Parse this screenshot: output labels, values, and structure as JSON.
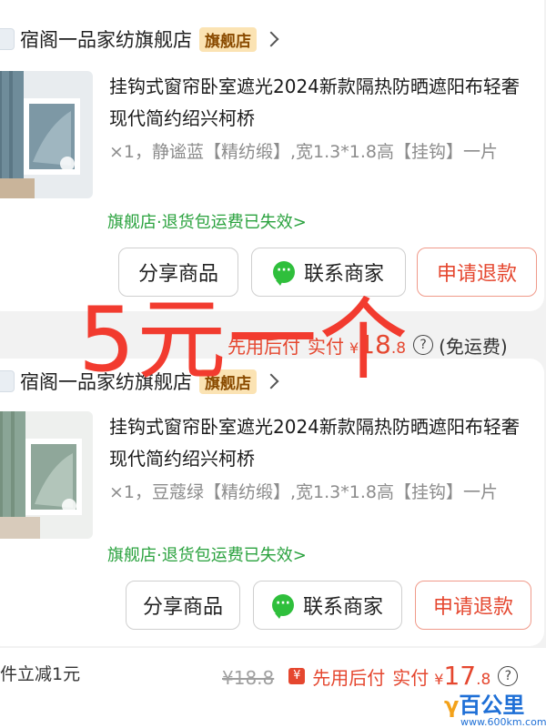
{
  "orders": [
    {
      "shop": {
        "name": "宿阁一品家纺旗舰店",
        "badge": "旗舰店"
      },
      "product": {
        "title": "挂钩式窗帘卧室遮光2024新款隔热防晒遮阳布轻奢现代简约绍兴柯桥",
        "sku": "×1，静谧蓝【精纺缎】,宽1.3*1.8高【挂钩】一片",
        "policy": "旗舰店·退货包运费已失效>",
        "thumb_color": "#7d98a5"
      },
      "buttons": {
        "share": "分享商品",
        "contact": "联系商家",
        "refund": "申请退款"
      },
      "price": {
        "pay_later": "先用后付",
        "paid_label": "实付",
        "currency": "¥",
        "amount_int": "18",
        "amount_dec": ".8",
        "shipping": "(免运费)"
      }
    },
    {
      "shop": {
        "name": "宿阁一品家纺旗舰店",
        "badge": "旗舰店"
      },
      "product": {
        "title": "挂钩式窗帘卧室遮光2024新款隔热防晒遮阳布轻奢现代简约绍兴柯桥",
        "sku": "×1，豆蔻绿【精纺缎】,宽1.3*1.8高【挂钩】一片",
        "policy": "旗舰店·退货包运费已失效>",
        "thumb_color": "#8fa79a"
      },
      "buttons": {
        "share": "分享商品",
        "contact": "联系商家",
        "refund": "申请退款"
      },
      "price": {
        "original": "¥18.8",
        "pay_later": "先用后付",
        "paid_label": "实付",
        "currency": "¥",
        "amount_int": "17",
        "amount_dec": ".8"
      },
      "promo": "件立减1元"
    }
  ],
  "overlay": "5元一个",
  "watermark": {
    "logo": "百公里",
    "url": "www.600km.com"
  },
  "colors": {
    "accent_red": "#e5472f",
    "policy_green": "#2aa23e",
    "badge_bg": "#fbe3b3"
  }
}
